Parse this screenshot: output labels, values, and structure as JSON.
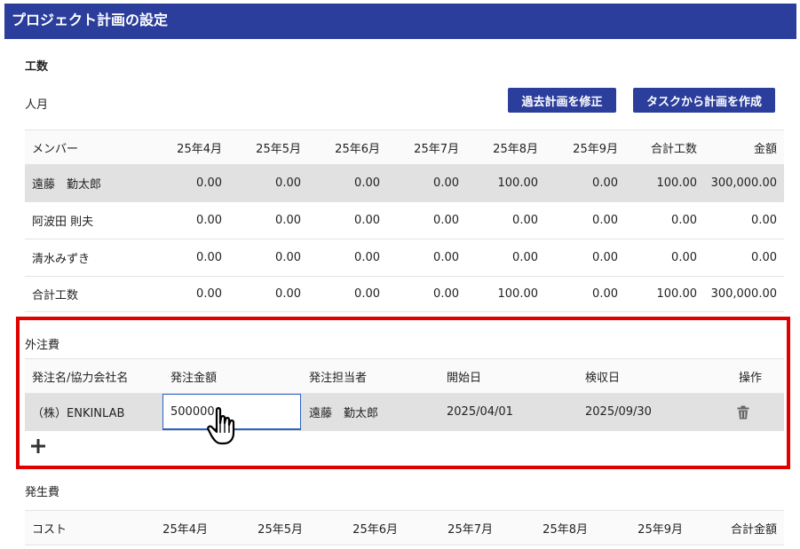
{
  "header": {
    "title": "プロジェクト計画の設定"
  },
  "manhours": {
    "section_title": "工数",
    "unit_label": "人月",
    "buttons": {
      "fix_past": "過去計画を修正",
      "create_from_tasks": "タスクから計画を作成"
    },
    "columns": [
      "メンバー",
      "25年4月",
      "25年5月",
      "25年6月",
      "25年7月",
      "25年8月",
      "25年9月",
      "合計工数",
      "金額"
    ],
    "rows": [
      {
        "name": "遠藤　勤太郎",
        "values": [
          "0.00",
          "0.00",
          "0.00",
          "0.00",
          "100.00",
          "0.00",
          "100.00",
          "300,000.00"
        ]
      },
      {
        "name": "阿波田 則夫",
        "values": [
          "0.00",
          "0.00",
          "0.00",
          "0.00",
          "0.00",
          "0.00",
          "0.00",
          "0.00"
        ]
      },
      {
        "name": "清水みずき",
        "values": [
          "0.00",
          "0.00",
          "0.00",
          "0.00",
          "0.00",
          "0.00",
          "0.00",
          "0.00"
        ]
      }
    ],
    "total": {
      "name": "合計工数",
      "values": [
        "0.00",
        "0.00",
        "0.00",
        "0.00",
        "100.00",
        "0.00",
        "100.00",
        "300,000.00"
      ]
    }
  },
  "outsourcing": {
    "section_title": "外注費",
    "columns": [
      "発注名/協力会社名",
      "発注金額",
      "発注担当者",
      "開始日",
      "検収日",
      "操作"
    ],
    "row": {
      "name": "（株）ENKINLAB",
      "amount": "500000",
      "manager": "遠藤　勤太郎",
      "start_date": "2025/04/01",
      "acceptance_date": "2025/09/30"
    },
    "icons": {
      "delete": "trash-icon",
      "add": "plus-icon",
      "cursor": "hand-pointer-icon"
    }
  },
  "incurred": {
    "section_title": "発生費",
    "columns": [
      "コスト",
      "25年4月",
      "25年5月",
      "25年6月",
      "25年7月",
      "25年8月",
      "25年9月",
      "合計金額"
    ]
  },
  "colors": {
    "header_bg": "#2c3e9c",
    "button_bg": "#2c3e9c",
    "highlight_border": "#e00000",
    "row_highlight": "#e1e1e1",
    "input_border": "#2b62c0"
  }
}
